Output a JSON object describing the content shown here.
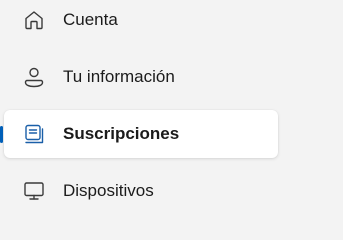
{
  "nav": {
    "items": [
      {
        "label": "Cuenta",
        "icon": "home-icon",
        "selected": false
      },
      {
        "label": "Tu información",
        "icon": "person-icon",
        "selected": false
      },
      {
        "label": "Suscripciones",
        "icon": "subscriptions-icon",
        "selected": true
      },
      {
        "label": "Dispositivos",
        "icon": "monitor-icon",
        "selected": false
      }
    ]
  },
  "colors": {
    "accent": "#005fb8",
    "background": "#f3f3f3",
    "selected_background": "#ffffff",
    "text": "#1b1b1b"
  }
}
